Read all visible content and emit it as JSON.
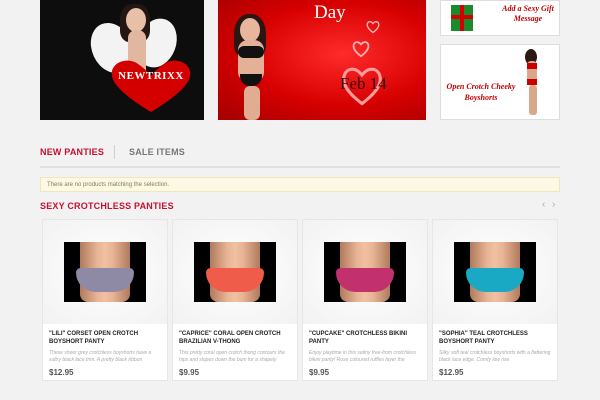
{
  "banners": {
    "left": {
      "script_text": "",
      "heart_label": "NEWTRIXX"
    },
    "middle": {
      "title": "Day",
      "date": "Feb 14"
    },
    "right_top": {
      "message": "Add a Sexy Gift Message"
    },
    "right_bottom": {
      "message": "Open Crotch Cheeky Boyshorts"
    }
  },
  "tabs": {
    "new_label": "NEW PANTIES",
    "sale_label": "SALE ITEMS"
  },
  "notice": "There are no products matching the selection.",
  "section": {
    "title": "SEXY CROTCHLESS PANTIES",
    "prev": "‹",
    "next": "›"
  },
  "products": [
    {
      "name": "\"LILI\" CORSET OPEN CROTCH BOYSHORT PANTY",
      "desc": "These sheer grey crotchless boyshorts have a sultry black lace trim. A pretty black ribbon",
      "price": "$12.95",
      "color": "#8e8aa6"
    },
    {
      "name": "\"CAPRICE\" CORAL OPEN CROTCH BRAZILIAN V-THONG",
      "desc": "This pretty coral open crotch thong contours the hips and slopes down the bum for a shapely",
      "price": "$9.95",
      "color": "#ef5c4a"
    },
    {
      "name": "\"CUPCAKE\" CROTCHLESS BIKINI PANTY",
      "desc": "Enjoy playtime in this satiny free-from crotchless bikini panty! Rose coloured ruffles layer the",
      "price": "$9.95",
      "color": "#c2306e"
    },
    {
      "name": "\"SOPHIA\" TEAL CROTCHLESS BOYSHORT PANTY",
      "desc": "Silky soft teal crotchless boyshorts with a flattering black lace edge. Comfy low rise",
      "price": "$12.95",
      "color": "#1aa9c4"
    }
  ]
}
